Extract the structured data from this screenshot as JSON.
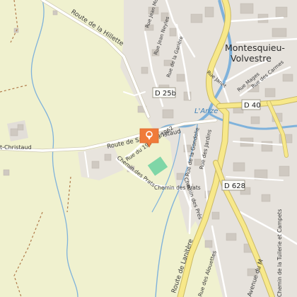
{
  "map": {
    "town_name_line1": "Montesquieu-",
    "town_name_line2": "Volvestre",
    "river": "L'Arize",
    "roads": {
      "d25b": "D 25b",
      "d40": "D 40",
      "d628": "D 628"
    },
    "streets": {
      "hillette": "Route de la Hillette",
      "st_christaud_left": "t-Christaud",
      "st_christaud_main": "Route de Saint-Christaud",
      "mars_1962": "Rue du 19 Mars 1962",
      "prats_a": "Chemin des Prats",
      "prats_b": "Chemin des Prats",
      "pres": "Chemin des Prés",
      "gondolie": "Rue de la Gondolie",
      "jardins": "Rue des Jardins",
      "lanitere": "Route de Lanitère",
      "alouettes": "Rue des Alouettes",
      "tuilerie": "Chemin de la Tuilerie et Campets",
      "avenue": "Avenue du M",
      "jean_moulin": "Rue Jean Moulin",
      "jean_neyles": "Rue Jean Neyles",
      "gariere": "Rue de la Garière",
      "janet": "Rue Janet",
      "mages": "Rue Mages",
      "carmes": "Rue des Carmes"
    },
    "marker_icon": "map-pin-icon",
    "colors": {
      "background": "#f0f1cf",
      "urban": "#e4e0da",
      "building": "#cfc9c1",
      "yellow_road": "#f7e88a",
      "road_outline": "#b8b29c",
      "water": "#7fb2db",
      "park": "#7fd6a7",
      "marker": "#f07b3a"
    }
  }
}
